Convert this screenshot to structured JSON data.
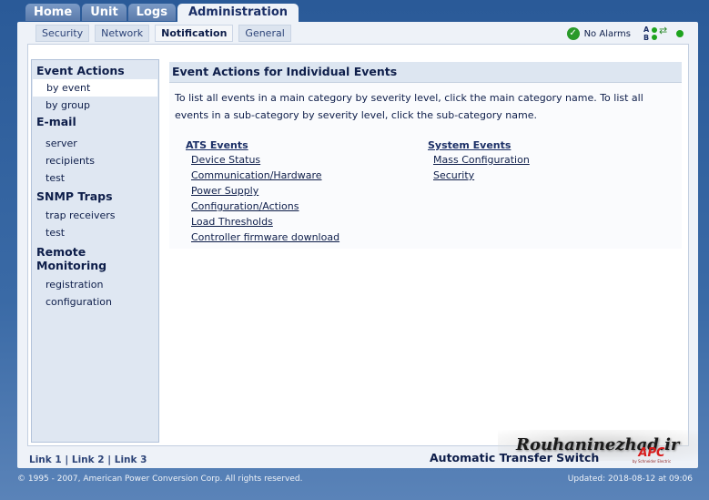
{
  "top_tabs": [
    "Home",
    "Unit",
    "Logs",
    "Administration"
  ],
  "sub_tabs": [
    "Security",
    "Network",
    "Notification",
    "General"
  ],
  "alarm": {
    "text": "No Alarms",
    "ab_a": "A",
    "ab_b": "B"
  },
  "sidebar": {
    "sections": [
      {
        "title": "Event Actions",
        "items": [
          "by event",
          "by group"
        ]
      },
      {
        "title": "E-mail",
        "items": [
          "server",
          "recipients",
          "test"
        ]
      },
      {
        "title": "SNMP Traps",
        "items": [
          "trap receivers",
          "test"
        ]
      },
      {
        "title": "Remote",
        "title2": "Monitoring",
        "items": [
          "registration",
          "configuration"
        ]
      }
    ]
  },
  "content": {
    "title": "Event Actions for Individual Events",
    "description": "To list all events in a main category by severity level, click the main category name. To list all events in a sub-category by severity level, click the sub-category name.",
    "ats": {
      "header": "ATS Events",
      "links": [
        "Device Status",
        "Communication/Hardware",
        "Power Supply",
        "Configuration/Actions",
        "Load Thresholds",
        "Controller firmware download"
      ]
    },
    "system": {
      "header": "System Events",
      "links": [
        "Mass Configuration",
        "Security"
      ]
    }
  },
  "footer": {
    "link1": "Link 1",
    "link2": "Link 2",
    "link3": "Link 3",
    "separator": "|",
    "product": "Automatic Transfer Switch",
    "logo": "APC",
    "logo_tag": "by Schneider Electric",
    "watermark": "Rouhaninezhad.ir",
    "copyright": "© 1995 - 2007, American Power Conversion Corp. All rights reserved.",
    "updated": "Updated: 2018-08-12 at 09:06"
  },
  "colors": {
    "accent": "#2a5a98",
    "alarm_ok": "#2a9a2a",
    "logo": "#d81b1b"
  }
}
